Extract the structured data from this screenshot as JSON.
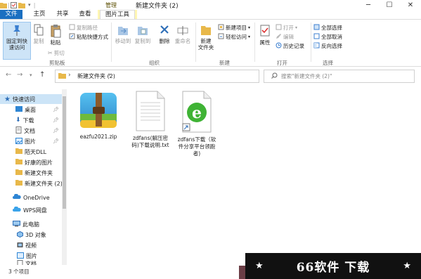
{
  "window": {
    "title": "新建文件夹 (2)",
    "context_tab_label": "管理",
    "controls": {
      "minimize": "─",
      "maximize": "☐",
      "close": "✕"
    }
  },
  "tabs": {
    "file": "文件",
    "home": "主页",
    "share": "共享",
    "view": "查看",
    "picture_tools": "图片工具"
  },
  "ribbon": {
    "clipboard": {
      "pin_quick_access": "固定到快\n速访问",
      "copy": "复制",
      "paste": "粘贴",
      "copy_path": "复制路径",
      "paste_shortcut": "粘贴快捷方式",
      "cut": "剪切",
      "group_label": "剪贴板"
    },
    "organize": {
      "move_to": "移动到",
      "copy_to": "复制到",
      "delete": "删除",
      "rename": "重命名",
      "group_label": "组织"
    },
    "new": {
      "new_folder": "新建\n文件夹",
      "new_item": "新建项目",
      "easy_access": "轻松访问",
      "group_label": "新建"
    },
    "open": {
      "properties": "属性",
      "open": "打开",
      "edit": "编辑",
      "history": "历史记录",
      "group_label": "打开"
    },
    "select": {
      "select_all": "全部选择",
      "select_none": "全部取消",
      "invert": "反向选择",
      "group_label": "选择"
    }
  },
  "address": {
    "path": "新建文件夹 (2)",
    "search_placeholder": "搜索\"新建文件夹 (2)\""
  },
  "nav_pane": {
    "quick_access": "快速访问",
    "items": [
      {
        "label": "桌面",
        "pinned": true
      },
      {
        "label": "下载",
        "pinned": true
      },
      {
        "label": "文档",
        "pinned": true
      },
      {
        "label": "图片",
        "pinned": true
      },
      {
        "label": "陌天DLL",
        "pinned": false
      },
      {
        "label": "好康的图片",
        "pinned": false
      },
      {
        "label": "新建文件夹",
        "pinned": false
      },
      {
        "label": "新建文件夹 (2)",
        "pinned": false
      }
    ],
    "onedrive": "OneDrive",
    "wps": "WPS网盘",
    "this_pc": "此电脑",
    "pc_items": [
      "3D 对象",
      "视频",
      "图片",
      "文档"
    ]
  },
  "files": [
    {
      "name": "eazfu2021.zip",
      "icon": "winrar-archive-icon"
    },
    {
      "name": "zdfans(解压密\n码)下载说明.txt",
      "icon": "text-file-icon"
    },
    {
      "name": "zdfans下载（软\n件分享平台领跑\n者)",
      "icon": "ie-shortcut-icon"
    }
  ],
  "status": {
    "item_count": "3 个项目"
  },
  "watermark": {
    "text": "66软件 下载",
    "star": "★"
  },
  "colors": {
    "file_tab": "#1a6fc1",
    "context_band": "#fff6b3",
    "selection": "#cce4f7"
  }
}
